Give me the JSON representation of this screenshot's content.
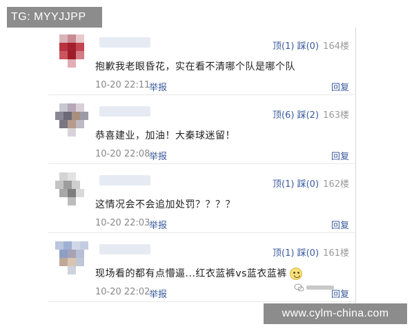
{
  "watermark_top": "TG: MYYJJPP",
  "watermark_bottom": "www.cylm-china.com",
  "wechat_mark_icon": "wechat-logo-icon",
  "accent_color": "#3a5a9c",
  "comments": [
    {
      "up_label": "顶(1)",
      "down_label": "踩(0)",
      "floor": "164楼",
      "text": "抱歉我老眼昏花，实在看不清哪个队是哪个队",
      "emoji": "",
      "date": "10-20 22:11",
      "report": "举报",
      "reply": "回复"
    },
    {
      "up_label": "顶(6)",
      "down_label": "踩(2)",
      "floor": "163楼",
      "text": "恭喜建业，加油！大秦球迷留！",
      "emoji": "",
      "date": "10-20 22:08",
      "report": "举报",
      "reply": "回复"
    },
    {
      "up_label": "顶(1)",
      "down_label": "踩(0)",
      "floor": "162楼",
      "text": "这情况会不会追加处罚？？？？",
      "emoji": "",
      "date": "10-20 22:03",
      "report": "举报",
      "reply": "回复"
    },
    {
      "up_label": "顶(1)",
      "down_label": "踩(0)",
      "floor": "161楼",
      "text": "现场看的都有点懵逼...红衣蓝裤vs蓝衣蓝裤",
      "emoji": "smiley-emoji-icon",
      "date": "10-20 22:02",
      "report": "举报",
      "reply": "回复"
    }
  ]
}
